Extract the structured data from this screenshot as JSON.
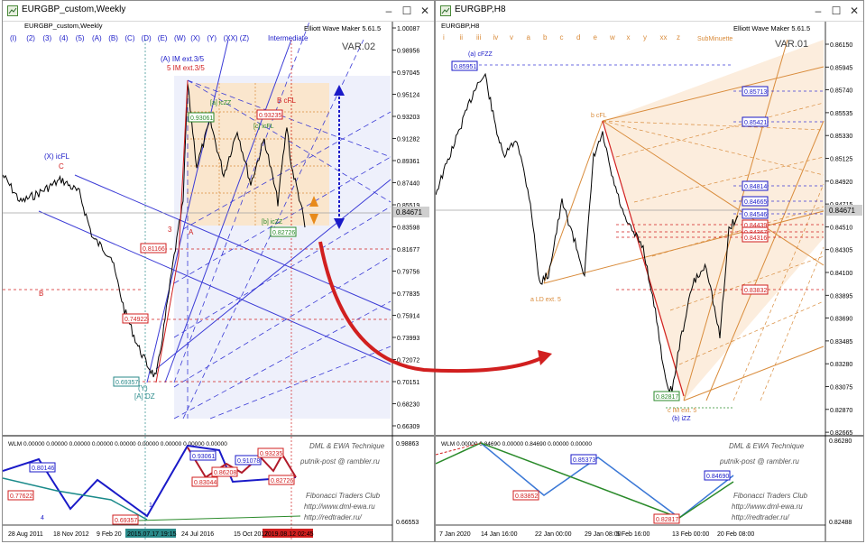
{
  "colors": {
    "grid_blue": "#3b3bd6",
    "grid_orange": "#d98c3c",
    "red": "#d11f1f",
    "green": "#2a8a2a",
    "navy": "#1a1ac8",
    "price_bg": "#cfcfcf"
  },
  "left": {
    "title": "EURGBP_custom,Weekly",
    "symbol_line": "EURGBP_custom,Weekly",
    "indicator_name": "Elliott Wave Maker 5.61.5",
    "var_label": "VAR.02",
    "degree_label": "Intermediate",
    "wave_labels": [
      "(I)",
      "(2)",
      "(3)",
      "(4)",
      "(5)",
      "(A)",
      "(B)",
      "(C)",
      "(D)",
      "(E)",
      "(W)",
      "(X)",
      "(Y)",
      "(XX)",
      "(Z)"
    ],
    "price_axis": [
      "1.00087",
      "0.98956",
      "0.97045",
      "0.95124",
      "0.93203",
      "0.91282",
      "0.89361",
      "0.87440",
      "0.85519",
      "0.83598",
      "0.81677",
      "0.79756",
      "0.77835",
      "0.75914",
      "0.73993",
      "0.72072",
      "0.70151",
      "0.68230",
      "0.66309"
    ],
    "current_price": "0.84671",
    "price_boxes": [
      "0.93235",
      "0.93061",
      "0.81166",
      "0.74922",
      "0.69357",
      "0.82726"
    ],
    "annotations": [
      "(A) IM ext.3/5",
      "5 IM ext.3/5",
      "B cFL",
      "(X) icFL",
      "[a] icZZ",
      "[b] icZZ",
      "[c] icFL",
      "[A] DZ",
      "(Y)",
      "C",
      "B",
      "A",
      "3",
      "4",
      "1"
    ],
    "osc_label": "WLM 0.00000 0.00000 0.00000 0.00000 0.00000 0.00000 0.00000 0.00000 0.00000",
    "osc_axis": [
      "0.98863",
      "0.66553"
    ],
    "osc_boxes": [
      "0.80146",
      "0.77622",
      "0.69357",
      "0.93061",
      "0.83044",
      "0.86208",
      "0.91078",
      "0.93235",
      "0.82726"
    ],
    "footer_text": [
      "DML & EWA Technique",
      "putnik-post @ rambler.ru",
      "Fibonacci Traders Club",
      "http://www.dml-ewa.ru",
      "http://redtrader.ru/"
    ],
    "time_axis": [
      "28 Aug 2011",
      "18 Nov 2012",
      "9 Feb 20",
      "2015.07.17 19:15",
      "24 Jul 2016",
      "15 Oct 2017",
      "2019.08.12 02:45"
    ]
  },
  "right": {
    "title": "EURGBP,H8",
    "symbol_line": "EURGBP,H8",
    "indicator_name": "Elliott Wave Maker 5.61.5",
    "var_label": "VAR.01",
    "degree_label": "SubMinuette",
    "wave_labels": [
      "i",
      "ii",
      "iii",
      "iv",
      "v",
      "a",
      "b",
      "c",
      "d",
      "e",
      "w",
      "x",
      "y",
      "xx",
      "z"
    ],
    "price_axis": [
      "0.86150",
      "0.85945",
      "0.85740",
      "0.85535",
      "0.85330",
      "0.85125",
      "0.84920",
      "0.84715",
      "0.84510",
      "0.84305",
      "0.84100",
      "0.83895",
      "0.83690",
      "0.83485",
      "0.83280",
      "0.83075",
      "0.82870",
      "0.82665"
    ],
    "current_price": "0.84671",
    "price_boxes_blue": [
      "0.85951",
      "0.85713",
      "0.85421",
      "0.84814",
      "0.84665",
      "0.84546"
    ],
    "price_boxes_red": [
      "0.84439",
      "0.84367",
      "0.84316",
      "0.83832",
      "0.82817"
    ],
    "annotations": [
      "(a) cFZZ",
      "b cFL",
      "a LD ext. 5",
      "c IM ext. 5",
      "(b) iZZ"
    ],
    "osc_label": "WLM 0.00000 0.84690 0.00000 0.84690 0.00000 0.00000",
    "osc_axis": [
      "0.86280",
      "0.82488"
    ],
    "osc_boxes": [
      "0.85373",
      "0.83852",
      "0.82817",
      "0.84690"
    ],
    "footer_text": [
      "DML & EWA Technique",
      "putnik-post @ rambler.ru",
      "Fibonacci Traders Club",
      "http://www.dml-ewa.ru",
      "http://redtrader.ru/"
    ],
    "time_axis": [
      "7 Jan 2020",
      "14 Jan 16:00",
      "22 Jan 00:00",
      "29 Jan 08:00",
      "5 Feb 16:00",
      "13 Feb 00:00",
      "20 Feb 08:00"
    ]
  },
  "chart_data": [
    {
      "type": "line",
      "title": "EURGBP_custom,Weekly",
      "x": [
        "28 Aug 2011",
        "18 Nov 2012",
        "9 Feb 2014",
        "2015.07.17",
        "24 Jul 2016",
        "15 Oct 2017",
        "2019.08.12"
      ],
      "series": [
        {
          "name": "EURGBP_custom,Weekly",
          "values": [
            0.86,
            0.81,
            0.8,
            0.7,
            0.86,
            0.89,
            0.85
          ]
        }
      ],
      "ylim": [
        0.66309,
        1.00087
      ]
    },
    {
      "type": "line",
      "title": "EURGBP,H8",
      "x": [
        "7 Jan 2020",
        "14 Jan 16:00",
        "22 Jan 00:00",
        "29 Jan 08:00",
        "5 Feb 16:00",
        "13 Feb 00:00",
        "20 Feb 08:00"
      ],
      "series": [
        {
          "name": "EURGBP,H8",
          "values": [
            0.85,
            0.856,
            0.847,
            0.841,
            0.85,
            0.829,
            0.839
          ]
        }
      ],
      "ylim": [
        0.82665,
        0.8615
      ]
    }
  ]
}
